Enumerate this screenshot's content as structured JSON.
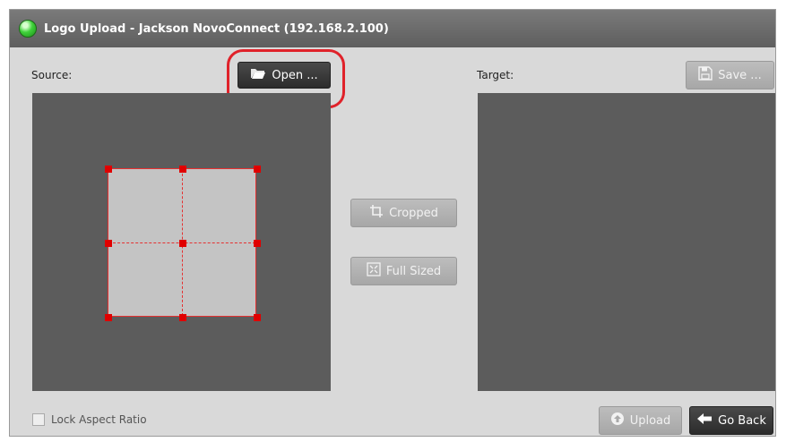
{
  "window": {
    "title": "Logo Upload - Jackson NovoConnect (192.168.2.100)"
  },
  "source": {
    "label": "Source:",
    "open_button": "Open ..."
  },
  "target": {
    "label": "Target:",
    "save_button": "Save ..."
  },
  "mode_buttons": {
    "cropped": "Cropped",
    "full_sized": "Full Sized"
  },
  "footer": {
    "lock_aspect_label": "Lock Aspect Ratio",
    "lock_aspect_checked": false,
    "upload_button": "Upload",
    "go_back_button": "Go Back"
  },
  "icons": {
    "status": "green-status-light",
    "open": "folder-open-icon",
    "save": "floppy-disk-icon",
    "cropped": "crop-icon",
    "full_sized": "fit-to-screen-icon",
    "upload": "upload-circle-icon",
    "go_back": "arrow-left-icon"
  },
  "colors": {
    "highlight_annotation": "#e0222a",
    "crop_selection": "#e53030",
    "status_light": "#3fd23a"
  }
}
